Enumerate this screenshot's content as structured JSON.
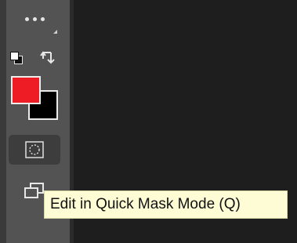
{
  "toolbar": {
    "more_tools_icon": "ellipsis-icon",
    "default_colors_icon": "default-colors-icon",
    "swap_colors_icon": "swap-colors-icon",
    "foreground_color": "#ee1c24",
    "background_color": "#000000",
    "quick_mask_icon": "quick-mask-icon",
    "screen_mode_icon": "screen-mode-icon"
  },
  "tooltip": {
    "text": "Edit in Quick Mask Mode (Q)"
  },
  "colors": {
    "toolbar_bg": "#535353",
    "canvas_bg": "#1e1e1e",
    "tooltip_bg": "#fdfcd4",
    "selected_button_bg": "#3d3d3d"
  }
}
